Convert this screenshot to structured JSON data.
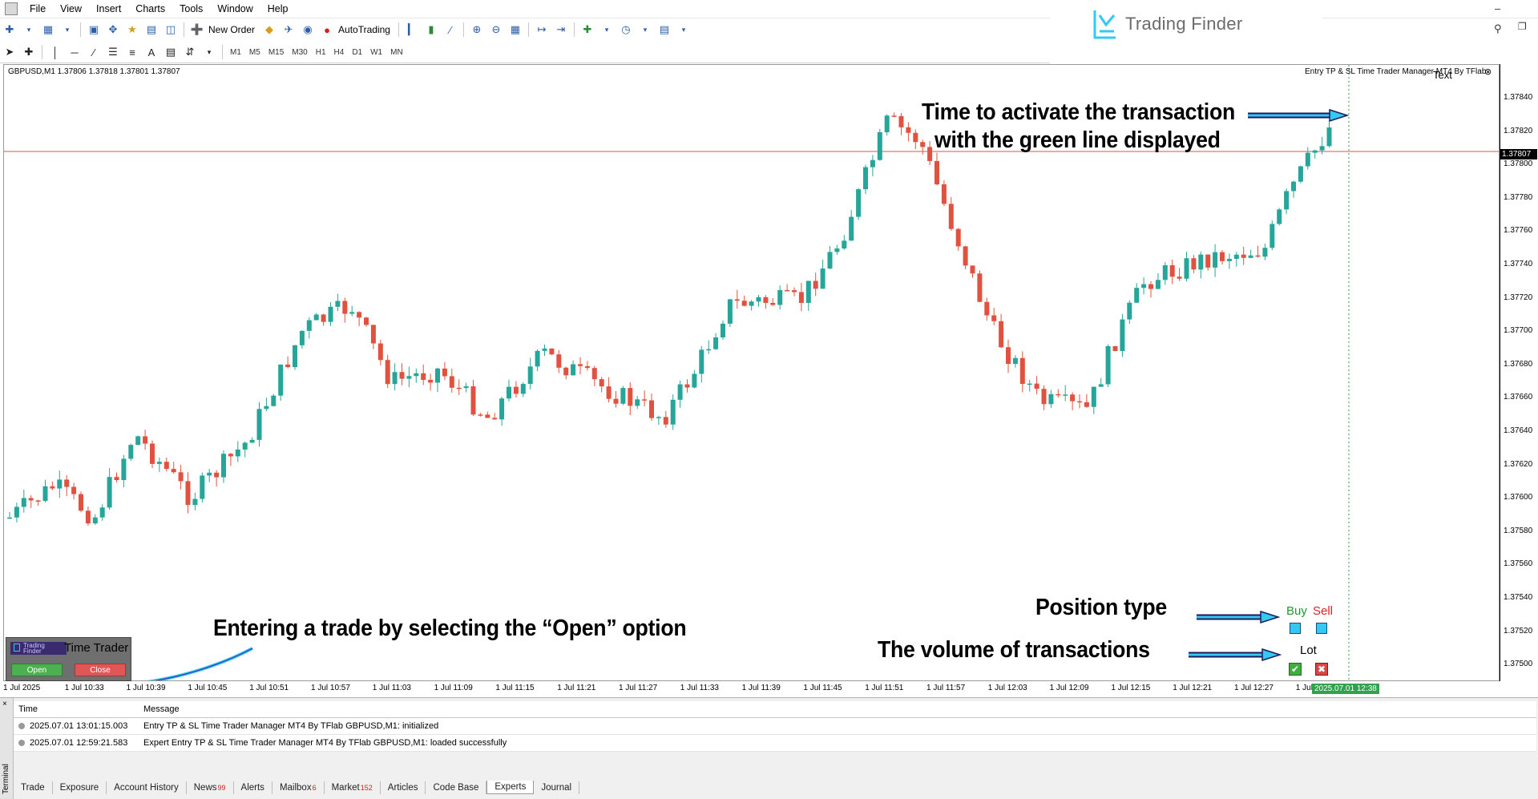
{
  "menu": [
    "File",
    "View",
    "Insert",
    "Charts",
    "Tools",
    "Window",
    "Help"
  ],
  "brand": {
    "name": "Trading Finder"
  },
  "toolbar": {
    "new_order": "New Order",
    "autotrading": "AutoTrading"
  },
  "timeframes": [
    "M1",
    "M5",
    "M15",
    "M30",
    "H1",
    "H4",
    "D1",
    "W1",
    "MN"
  ],
  "chart": {
    "header": "GBPUSD,M1  1.37806 1.37818 1.37801 1.37807",
    "ea_title": "Entry TP & SL Time Trader Manager MT4 By TFlab",
    "ea_text": "Text",
    "current_price": "1.37807",
    "current_time": "2025.07.01 12:38",
    "colors": {
      "bull": "#26a69a",
      "bear": "#e0523f",
      "price_line": "#d9534f",
      "time_line": "#2e9e3e"
    }
  },
  "price_axis": [
    "1.37840",
    "1.37820",
    "1.37800",
    "1.37780",
    "1.37760",
    "1.37740",
    "1.37720",
    "1.37700",
    "1.37680",
    "1.37660",
    "1.37640",
    "1.37620",
    "1.37600",
    "1.37580",
    "1.37560",
    "1.37540",
    "1.37520",
    "1.37500"
  ],
  "time_axis": [
    "1 Jul 2025",
    "1 Jul 10:33",
    "1 Jul 10:39",
    "1 Jul 10:45",
    "1 Jul 10:51",
    "1 Jul 10:57",
    "1 Jul 11:03",
    "1 Jul 11:09",
    "1 Jul 11:15",
    "1 Jul 11:21",
    "1 Jul 11:27",
    "1 Jul 11:33",
    "1 Jul 11:39",
    "1 Jul 11:45",
    "1 Jul 11:51",
    "1 Jul 11:57",
    "1 Jul 12:03",
    "1 Jul 12:09",
    "1 Jul 12:15",
    "1 Jul 12:21",
    "1 Jul 12:27",
    "1 Jul"
  ],
  "annotations": {
    "time_line_1": "Time to activate the transaction",
    "time_line_2": "with the green line displayed",
    "open_hint": "Entering a trade by selecting the “Open” option",
    "position_type": "Position type",
    "volume": "The volume of transactions"
  },
  "panel": {
    "logo_line1": "Trading",
    "logo_line2": "Finder",
    "title": "Time Trader",
    "open": "Open",
    "close": "Close"
  },
  "position": {
    "buy": "Buy",
    "sell": "Sell",
    "lot": "Lot"
  },
  "terminal": {
    "side_label": "Terminal",
    "columns": {
      "time": "Time",
      "message": "Message"
    },
    "rows": [
      {
        "time": "2025.07.01 13:01:15.003",
        "message": "Entry TP & SL Time Trader Manager MT4 By TFlab GBPUSD,M1: initialized"
      },
      {
        "time": "2025.07.01 12:59:21.583",
        "message": "Expert Entry TP & SL Time Trader Manager MT4 By TFlab GBPUSD,M1: loaded successfully"
      }
    ],
    "tabs": [
      {
        "label": "Trade",
        "badge": ""
      },
      {
        "label": "Exposure",
        "badge": ""
      },
      {
        "label": "Account History",
        "badge": ""
      },
      {
        "label": "News",
        "badge": "99"
      },
      {
        "label": "Alerts",
        "badge": ""
      },
      {
        "label": "Mailbox",
        "badge": "6"
      },
      {
        "label": "Market",
        "badge": "152"
      },
      {
        "label": "Articles",
        "badge": ""
      },
      {
        "label": "Code Base",
        "badge": ""
      },
      {
        "label": "Experts",
        "badge": ""
      },
      {
        "label": "Journal",
        "badge": ""
      }
    ]
  }
}
